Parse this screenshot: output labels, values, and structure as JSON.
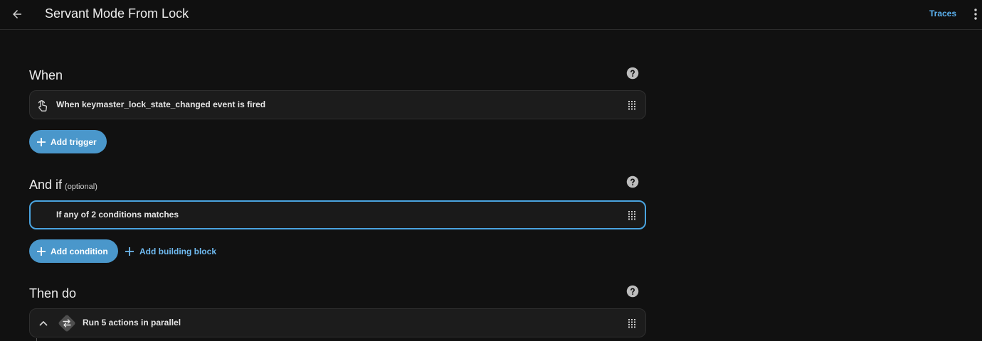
{
  "header": {
    "title": "Servant Mode From Lock",
    "traces_label": "Traces"
  },
  "when": {
    "title": "When",
    "trigger_label": "When keymaster_lock_state_changed event is fired",
    "add_trigger_label": "Add trigger"
  },
  "and_if": {
    "title": "And if",
    "optional_label": "(optional)",
    "condition_label": "If any of 2 conditions matches",
    "add_condition_label": "Add condition",
    "add_building_block_label": "Add building block"
  },
  "then_do": {
    "title": "Then do",
    "action_label": "Run 5 actions in parallel"
  },
  "colors": {
    "accent": "#4a97cb",
    "link": "#5bb1ef",
    "background": "#111111",
    "card": "#1c1c1c"
  },
  "icons": {
    "back": "arrow-left-icon",
    "more": "dots-vertical-icon",
    "help": "help-circle-icon",
    "trigger": "gesture-tap-icon",
    "drag": "drag-handle-icon",
    "plus": "plus-icon",
    "chevron": "chevron-up-icon",
    "parallel": "shuffle-disabled-icon"
  }
}
